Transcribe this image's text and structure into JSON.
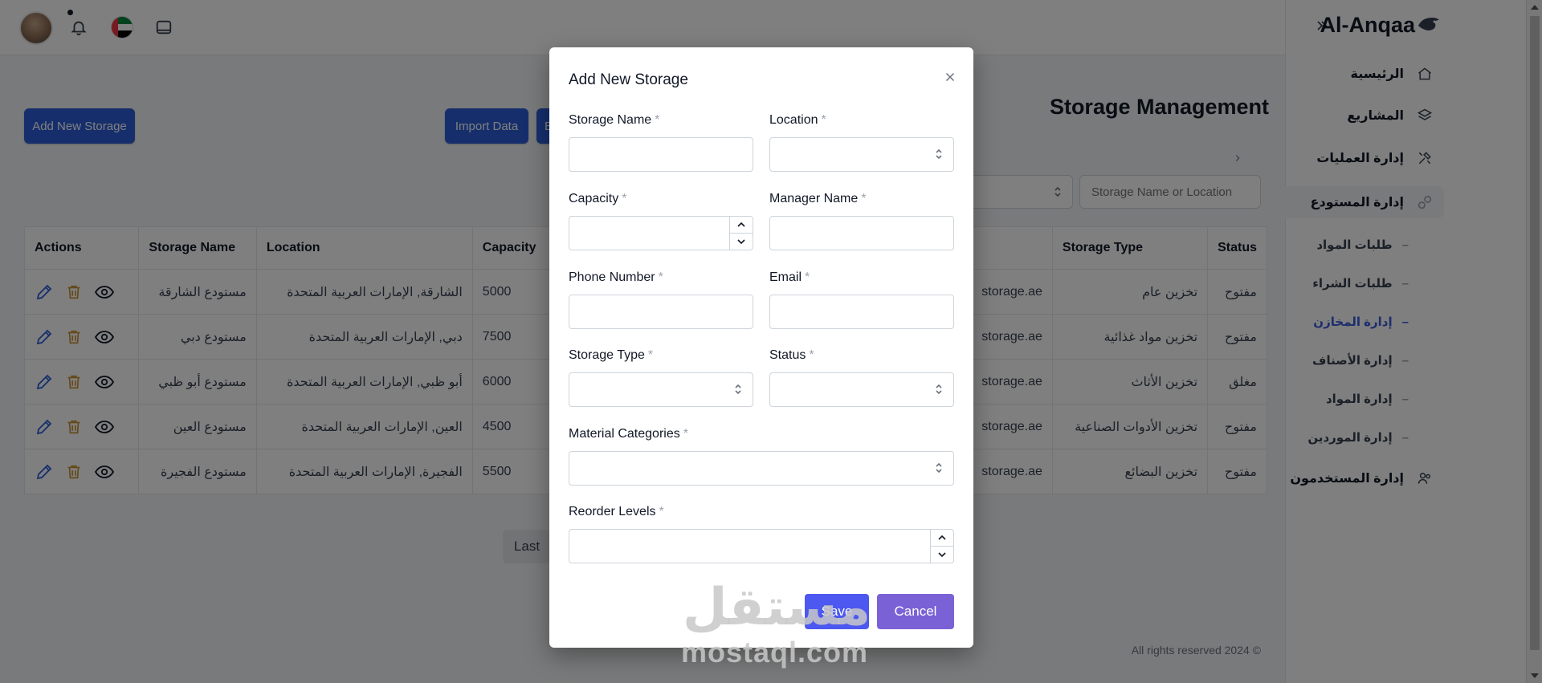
{
  "brand": {
    "name": "Al-Anqaa"
  },
  "sidebar": {
    "items": [
      {
        "label": "الرئيسية",
        "icon": "home-icon"
      },
      {
        "label": "المشاريع",
        "icon": "layers-icon"
      },
      {
        "label": "إدارة العمليات",
        "icon": "tools-icon"
      },
      {
        "label": "إدارة المستودع",
        "icon": "warehouse-icon"
      },
      {
        "label": "إدارة المستخدمون",
        "icon": "users-icon"
      }
    ],
    "subitems": [
      {
        "label": "طلبات المواد"
      },
      {
        "label": "طلبات الشراء"
      },
      {
        "label": "إدارة المخازن"
      },
      {
        "label": "إدارة الأصناف"
      },
      {
        "label": "إدارة المواد"
      },
      {
        "label": "إدارة الموردين"
      }
    ]
  },
  "main": {
    "title": "Storage Management",
    "add_button": "Add New Storage",
    "import_button": "Import Data",
    "export_button_partial": "E",
    "search_placeholder": "Storage Name or Location",
    "pager_last": "Last",
    "footer": "All rights reserved 2024 ©"
  },
  "table": {
    "headers": {
      "actions": "Actions",
      "name": "Storage Name",
      "location": "Location",
      "capacity": "Capacity",
      "type": "Storage Type",
      "status": "Status"
    },
    "rows": [
      {
        "name": "مستودع الشارقة",
        "location": "الشارقة, الإمارات العربية المتحدة",
        "capacity": "5000",
        "email_tail": "storage.ae",
        "type": "تخزين عام",
        "status": "مفتوح"
      },
      {
        "name": "مستودع دبي",
        "location": "دبي, الإمارات العربية المتحدة",
        "capacity": "7500",
        "email_tail": "storage.ae",
        "type": "تخزين مواد غذائية",
        "status": "مفتوح"
      },
      {
        "name": "مستودع أبو ظبي",
        "location": "أبو ظبي, الإمارات العربية المتحدة",
        "capacity": "6000",
        "email_tail": "storage.ae",
        "type": "تخزين الأثاث",
        "status": "مغلق"
      },
      {
        "name": "مستودع العين",
        "location": "العين, الإمارات العربية المتحدة",
        "capacity": "4500",
        "email_tail": "storage.ae",
        "type": "تخزين الأدوات الصناعية",
        "status": "مفتوح"
      },
      {
        "name": "مستودع الفجيرة",
        "location": "الفجيرة, الإمارات العربية المتحدة",
        "capacity": "5500",
        "email_tail": "storage.ae",
        "type": "تخزين البضائع",
        "status": "مفتوح"
      }
    ]
  },
  "modal": {
    "title": "Add New Storage",
    "required_mark": "*",
    "save": "Save",
    "cancel": "Cancel",
    "fields": {
      "storage_name": {
        "label": "Storage Name",
        "value": ""
      },
      "location": {
        "label": "Location",
        "value": ""
      },
      "capacity": {
        "label": "Capacity",
        "value": ""
      },
      "manager_name": {
        "label": "Manager Name",
        "value": ""
      },
      "phone": {
        "label": "Phone Number",
        "value": ""
      },
      "email": {
        "label": "Email",
        "value": ""
      },
      "storage_type": {
        "label": "Storage Type",
        "value": ""
      },
      "status": {
        "label": "Status",
        "value": ""
      },
      "material_categories": {
        "label": "Material Categories",
        "value": ""
      },
      "reorder_levels": {
        "label": "Reorder Levels",
        "value": ""
      }
    }
  },
  "watermark": {
    "arabic": "مستقل",
    "latin": "mostaql.com"
  },
  "colors": {
    "primary": "#2d5fd8",
    "save": "#4c58f0",
    "cancel": "#7b61d6",
    "active_link": "#3b5bdb"
  }
}
